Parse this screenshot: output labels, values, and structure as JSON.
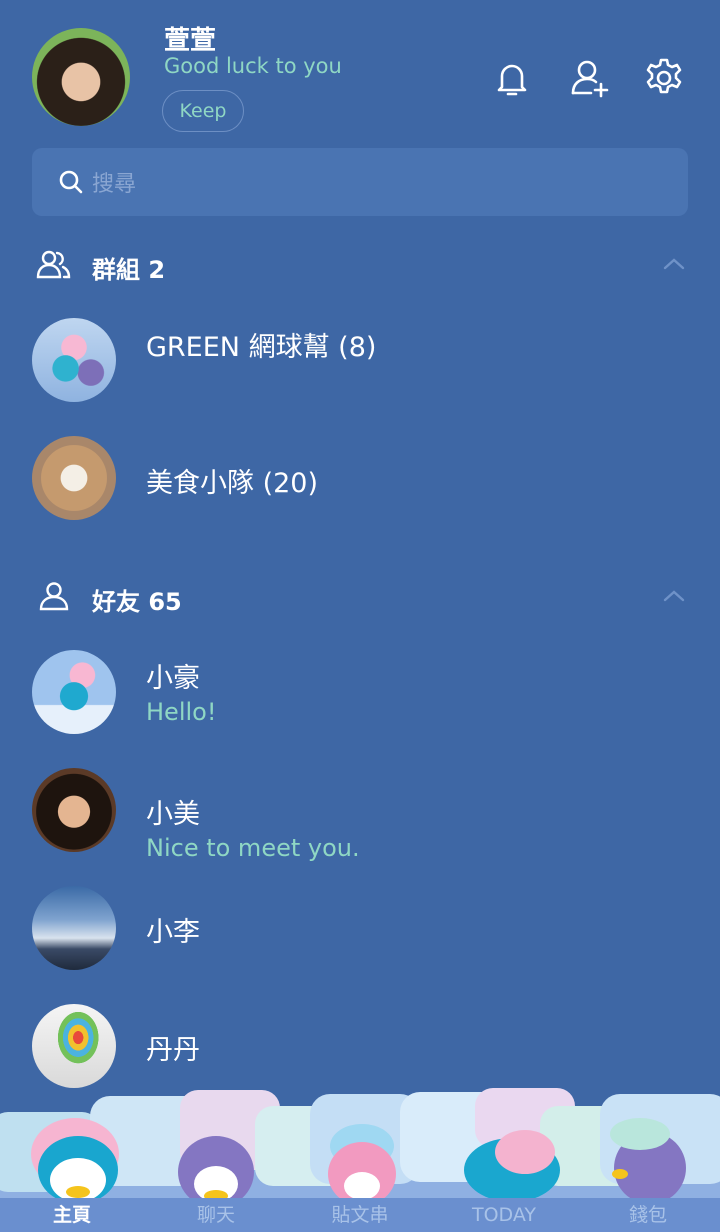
{
  "profile": {
    "name": "萱萱",
    "status": "Good luck to you",
    "keep_label": "Keep"
  },
  "header_icons": [
    "bell-icon",
    "add-friend-icon",
    "gear-icon"
  ],
  "search": {
    "placeholder": "搜尋"
  },
  "groups": {
    "title": "群組 2",
    "items": [
      {
        "name": "GREEN 網球幫 (8)"
      },
      {
        "name": "美食小隊 (20)"
      }
    ]
  },
  "friends": {
    "title": "好友 65",
    "items": [
      {
        "name": "小豪",
        "status": "Hello!"
      },
      {
        "name": "小美",
        "status": "Nice to meet you."
      },
      {
        "name": "小李",
        "status": ""
      },
      {
        "name": "丹丹",
        "status": ""
      }
    ]
  },
  "tabs": [
    {
      "label": "主頁",
      "active": true
    },
    {
      "label": "聊天",
      "active": false
    },
    {
      "label": "貼文串",
      "active": false
    },
    {
      "label": "TODAY",
      "active": false
    },
    {
      "label": "錢包",
      "active": false
    }
  ],
  "colors": {
    "background": "#3e67a5",
    "accent_text": "#8fd7c4",
    "search_bg": "#4a74b2"
  }
}
